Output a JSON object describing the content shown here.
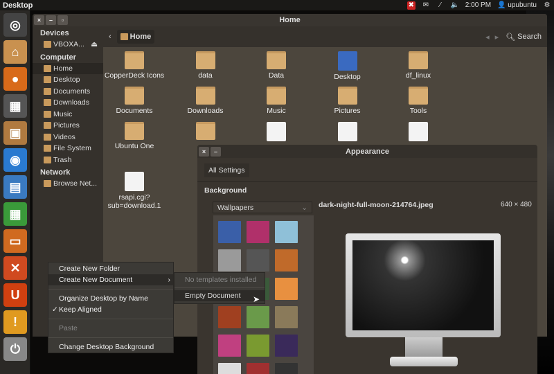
{
  "panel": {
    "title": "Desktop",
    "time": "2:00 PM",
    "user": "upubuntu"
  },
  "file_manager": {
    "title": "Home",
    "location": "Home",
    "search_label": "Search",
    "sidebar": {
      "sections": [
        {
          "header": "Devices",
          "items": [
            {
              "label": "VBOXA..."
            }
          ]
        },
        {
          "header": "Computer",
          "items": [
            {
              "label": "Home"
            },
            {
              "label": "Desktop"
            },
            {
              "label": "Documents"
            },
            {
              "label": "Downloads"
            },
            {
              "label": "Music"
            },
            {
              "label": "Pictures"
            },
            {
              "label": "Videos"
            },
            {
              "label": "File System"
            },
            {
              "label": "Trash"
            }
          ]
        },
        {
          "header": "Network",
          "items": [
            {
              "label": "Browse Net..."
            }
          ]
        }
      ]
    },
    "files": [
      {
        "name": "CopperDeck Icons",
        "type": "folder"
      },
      {
        "name": "data",
        "type": "folder"
      },
      {
        "name": "Data",
        "type": "folder"
      },
      {
        "name": "Desktop",
        "type": "desktop"
      },
      {
        "name": "df_linux",
        "type": "folder"
      },
      {
        "name": "Documents",
        "type": "folder"
      },
      {
        "name": "Downloads",
        "type": "folder"
      },
      {
        "name": "Music",
        "type": "folder"
      },
      {
        "name": "Pictures",
        "type": "folder"
      },
      {
        "name": "Tools",
        "type": "folder"
      },
      {
        "name": "Ubuntu One",
        "type": "folder"
      },
      {
        "name": "",
        "type": "folder"
      },
      {
        "name": "",
        "type": "file"
      },
      {
        "name": "",
        "type": "archive"
      },
      {
        "name": "",
        "type": "file"
      },
      {
        "name": "rsapi.cgi?\nsub=download.1",
        "type": "file"
      }
    ]
  },
  "appearance": {
    "title": "Appearance",
    "all_settings": "All Settings",
    "section": "Background",
    "dropdown": "Wallpapers",
    "filename": "dark-night-full-moon-214764.jpeg",
    "resolution": "640 × 480",
    "thumbnail_colors": [
      "#3a5fa8",
      "#b0306a",
      "#8fc0d8",
      "#9a9a9a",
      "#555",
      "#c06a2a",
      "#2a2a2a",
      "#3a5a3a",
      "#e89040",
      "#a04020",
      "#6a9a4a",
      "#8a7a5a",
      "#c04080",
      "#7a9a30",
      "#3a2a5a",
      "#ddd",
      "#a03030",
      "#333"
    ]
  },
  "context_menu": {
    "items": [
      {
        "label": "Create New Folder"
      },
      {
        "label": "Create New Document",
        "submenu": true
      },
      {
        "label": "Organize Desktop by Name"
      },
      {
        "label": "Keep Aligned",
        "checked": true
      },
      {
        "label": "Paste",
        "disabled": true
      },
      {
        "label": "Change Desktop Background"
      }
    ],
    "submenu": {
      "empty": "No templates installed",
      "items": [
        {
          "label": "Empty Document"
        }
      ]
    }
  }
}
